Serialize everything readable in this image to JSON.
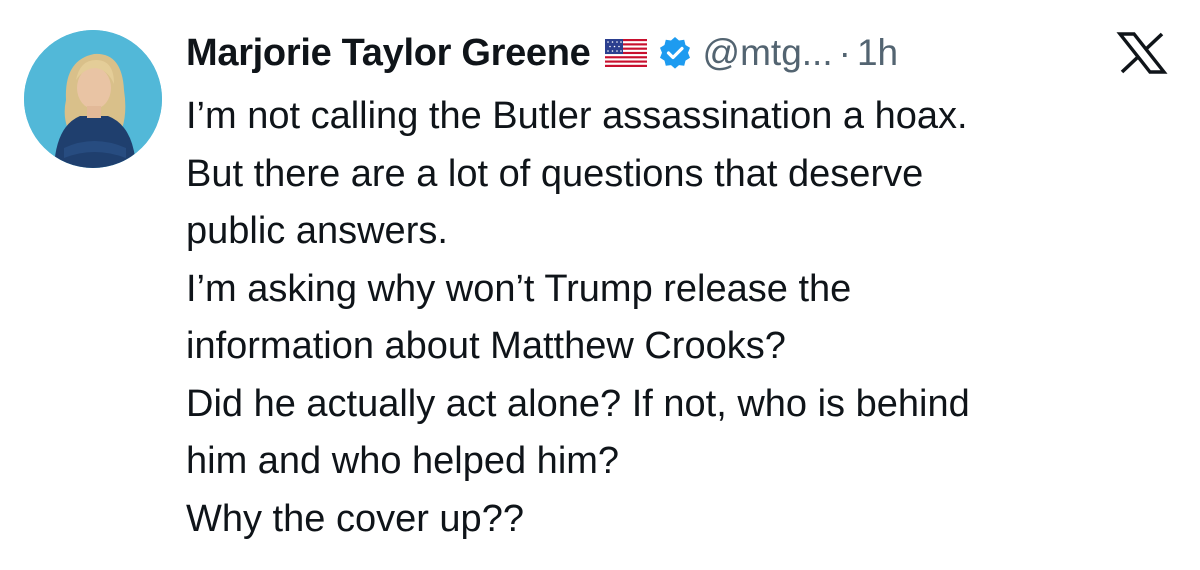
{
  "tweet": {
    "author_name": "Marjorie Taylor Greene",
    "handle": "@mtg...",
    "separator": "·",
    "time": "1h",
    "flag_icon": "us-flag-icon",
    "verified_icon": "verified-badge-icon",
    "verified_color": "#1d9bf0",
    "platform_icon": "x-logo-icon",
    "lines": [
      "I’m not calling the Butler assassination a hoax.",
      "But there are a lot of questions that deserve",
      "public answers.",
      "I’m asking why won’t Trump release the",
      "information about Matthew Crooks?",
      "Did he actually act alone? If not, who is behind",
      "him and who helped him?",
      "Why the cover up??"
    ]
  }
}
